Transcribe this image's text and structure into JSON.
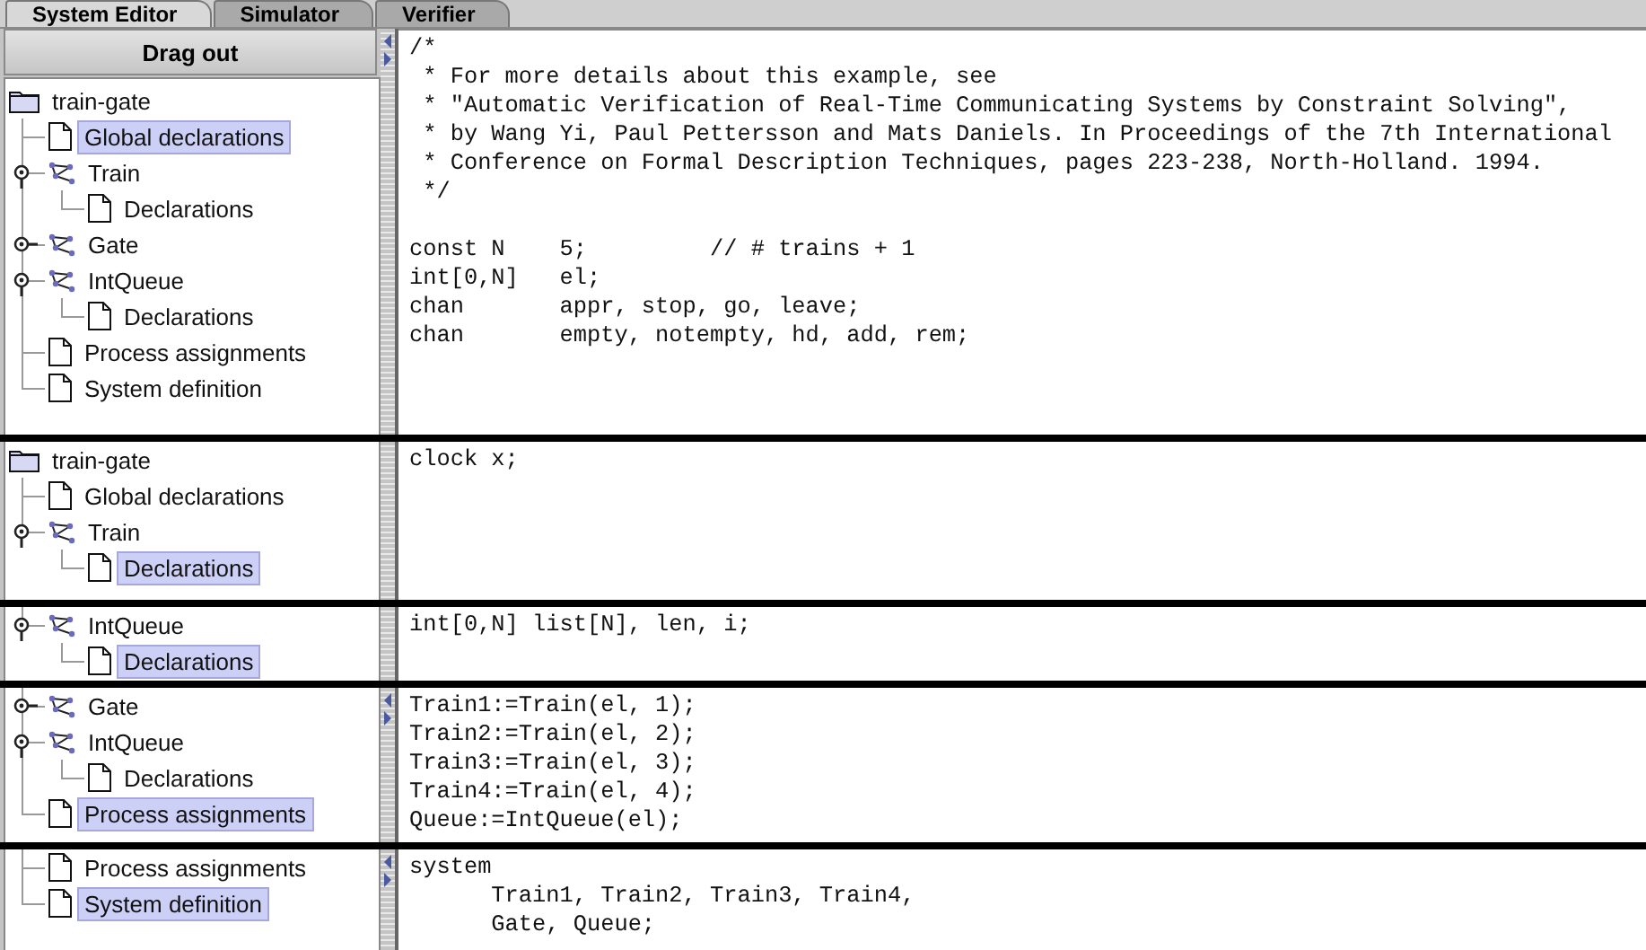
{
  "tabs": [
    {
      "label": "System Editor",
      "selected": true
    },
    {
      "label": "Simulator",
      "selected": false
    },
    {
      "label": "Verifier",
      "selected": false
    }
  ],
  "panels": [
    {
      "drag_out_button": "Drag out",
      "root_visible": true,
      "splitter_arrows": true,
      "tree": [
        {
          "kind": "folder",
          "label": "train-gate",
          "selected": false,
          "children": [
            {
              "kind": "document",
              "label": "Global declarations",
              "selected": true
            },
            {
              "kind": "template",
              "label": "Train",
              "selected": false,
              "expanded": true,
              "children": [
                {
                  "kind": "document",
                  "label": "Declarations",
                  "selected": false
                }
              ]
            },
            {
              "kind": "template",
              "label": "Gate",
              "selected": false,
              "expanded": false
            },
            {
              "kind": "template",
              "label": "IntQueue",
              "selected": false,
              "expanded": true,
              "children": [
                {
                  "kind": "document",
                  "label": "Declarations",
                  "selected": false
                }
              ]
            },
            {
              "kind": "document",
              "label": "Process assignments",
              "selected": false
            },
            {
              "kind": "document",
              "label": "System definition",
              "selected": false
            }
          ]
        }
      ],
      "code": "/*\n * For more details about this example, see\n * \"Automatic Verification of Real-Time Communicating Systems by Constraint Solving\",\n * by Wang Yi, Paul Pettersson and Mats Daniels. In Proceedings of the 7th International\n * Conference on Formal Description Techniques, pages 223-238, North-Holland. 1994.\n */\n\nconst N    5;         // # trains + 1\nint[0,N]   el;\nchan       appr, stop, go, leave;\nchan       empty, notempty, hd, add, rem;"
    },
    {
      "root_visible": true,
      "splitter_arrows": false,
      "tree": [
        {
          "kind": "folder",
          "label": "train-gate",
          "selected": false,
          "children": [
            {
              "kind": "document",
              "label": "Global declarations",
              "selected": false
            },
            {
              "kind": "template",
              "label": "Train",
              "selected": false,
              "expanded": true,
              "children": [
                {
                  "kind": "document",
                  "label": "Declarations",
                  "selected": true
                }
              ]
            }
          ]
        }
      ],
      "code": "clock x;"
    },
    {
      "root_visible": false,
      "splitter_arrows": false,
      "tree": [
        {
          "kind": "template",
          "label": "IntQueue",
          "selected": false,
          "expanded": true,
          "children": [
            {
              "kind": "document",
              "label": "Declarations",
              "selected": true
            }
          ]
        }
      ],
      "code": "int[0,N] list[N], len, i;"
    },
    {
      "root_visible": false,
      "splitter_arrows": true,
      "tree": [
        {
          "kind": "template",
          "label": "Gate",
          "selected": false,
          "expanded": false
        },
        {
          "kind": "template",
          "label": "IntQueue",
          "selected": false,
          "expanded": true,
          "children": [
            {
              "kind": "document",
              "label": "Declarations",
              "selected": false
            }
          ]
        },
        {
          "kind": "document",
          "label": "Process assignments",
          "selected": true
        }
      ],
      "code": "Train1:=Train(el, 1);\nTrain2:=Train(el, 2);\nTrain3:=Train(el, 3);\nTrain4:=Train(el, 4);\nQueue:=IntQueue(el);"
    },
    {
      "root_visible": false,
      "splitter_arrows": true,
      "tree": [
        {
          "kind": "document",
          "label": "Process assignments",
          "selected": false
        },
        {
          "kind": "document",
          "label": "System definition",
          "selected": true
        }
      ],
      "code": "system\n      Train1, Train2, Train3, Train4,\n      Gate, Queue;"
    }
  ]
}
